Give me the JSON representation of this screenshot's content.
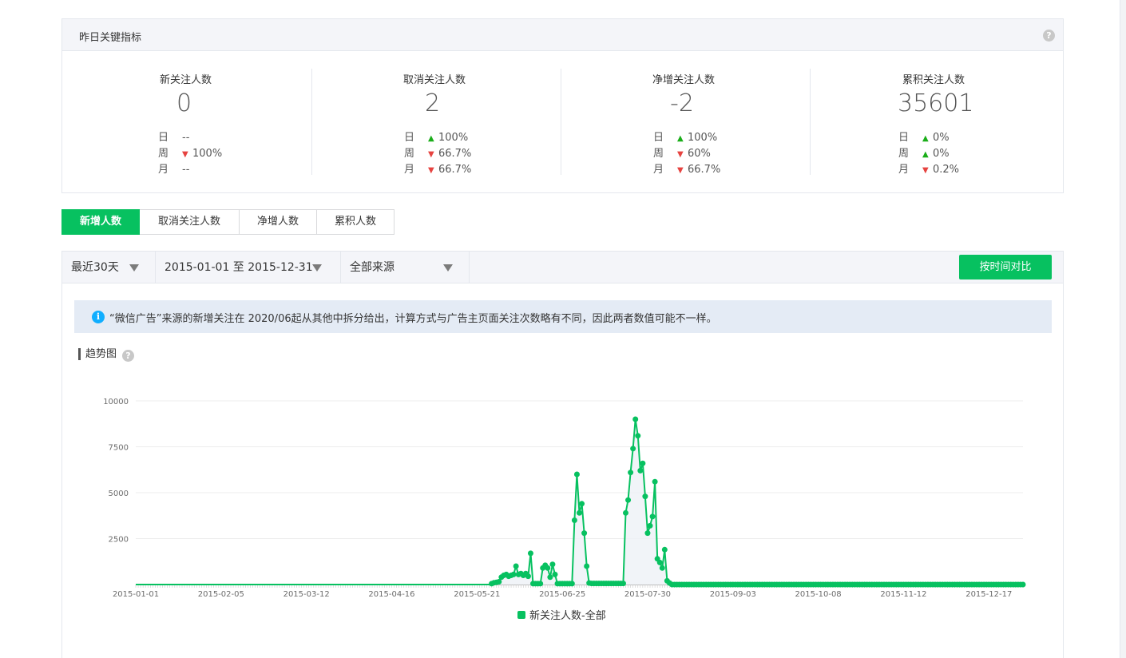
{
  "metrics": {
    "title": "昨日关键指标",
    "help_icon": "question-icon",
    "cards": [
      {
        "name": "新关注人数",
        "value": "0",
        "rows": [
          {
            "label": "日",
            "dir": "",
            "value": "--"
          },
          {
            "label": "周",
            "dir": "down",
            "value": "100%"
          },
          {
            "label": "月",
            "dir": "",
            "value": "--"
          }
        ]
      },
      {
        "name": "取消关注人数",
        "value": "2",
        "rows": [
          {
            "label": "日",
            "dir": "up",
            "value": "100%"
          },
          {
            "label": "周",
            "dir": "down",
            "value": "66.7%"
          },
          {
            "label": "月",
            "dir": "down",
            "value": "66.7%"
          }
        ]
      },
      {
        "name": "净增关注人数",
        "value": "-2",
        "rows": [
          {
            "label": "日",
            "dir": "up",
            "value": "100%"
          },
          {
            "label": "周",
            "dir": "down",
            "value": "60%"
          },
          {
            "label": "月",
            "dir": "down",
            "value": "66.7%"
          }
        ]
      },
      {
        "name": "累积关注人数",
        "value": "35601",
        "rows": [
          {
            "label": "日",
            "dir": "up",
            "value": "0%"
          },
          {
            "label": "周",
            "dir": "up",
            "value": "0%"
          },
          {
            "label": "月",
            "dir": "down",
            "value": "0.2%"
          }
        ]
      }
    ]
  },
  "tabs": [
    {
      "label": "新增人数",
      "active": true
    },
    {
      "label": "取消关注人数",
      "active": false
    },
    {
      "label": "净增人数",
      "active": false
    },
    {
      "label": "累积人数",
      "active": false
    }
  ],
  "filters": {
    "period": "最近30天",
    "date_range": "2015-01-01 至 2015-12-31",
    "source": "全部来源",
    "compare_button": "按时间对比"
  },
  "notice": {
    "icon": "info-icon",
    "text": "“微信广告”来源的新增关注在 2020/06起从其他中拆分给出，计算方式与广告主页面关注次数略有不同，因此两者数值可能不一样。"
  },
  "trend": {
    "title": "趋势图"
  },
  "colors": {
    "accent": "#07c160",
    "up": "#1aad19",
    "down": "#e64340",
    "info": "#10aeff"
  },
  "chart_data": {
    "type": "line",
    "x_start": "2015-01-01",
    "x_end": "2015-12-31",
    "x_ticks": [
      "2015-01-01",
      "2015-02-05",
      "2015-03-12",
      "2015-04-16",
      "2015-05-21",
      "2015-06-25",
      "2015-07-30",
      "2015-09-03",
      "2015-10-08",
      "2015-11-12",
      "2015-12-17"
    ],
    "y_ticks": [
      2500,
      5000,
      7500,
      10000
    ],
    "ylim": [
      0,
      10000
    ],
    "grid": true,
    "legend_position": "bottom",
    "series": [
      {
        "name": "新关注人数-全部",
        "baseline_value": 0,
        "points": [
          [
            "2015-05-27",
            50
          ],
          [
            "2015-05-28",
            100
          ],
          [
            "2015-05-29",
            120
          ],
          [
            "2015-05-30",
            150
          ],
          [
            "2015-05-31",
            400
          ],
          [
            "2015-06-01",
            500
          ],
          [
            "2015-06-02",
            550
          ],
          [
            "2015-06-03",
            450
          ],
          [
            "2015-06-04",
            500
          ],
          [
            "2015-06-05",
            550
          ],
          [
            "2015-06-06",
            1000
          ],
          [
            "2015-06-07",
            550
          ],
          [
            "2015-06-08",
            600
          ],
          [
            "2015-06-09",
            500
          ],
          [
            "2015-06-10",
            600
          ],
          [
            "2015-06-11",
            450
          ],
          [
            "2015-06-12",
            1700
          ],
          [
            "2015-06-13",
            50
          ],
          [
            "2015-06-14",
            50
          ],
          [
            "2015-06-15",
            50
          ],
          [
            "2015-06-16",
            50
          ],
          [
            "2015-06-17",
            900
          ],
          [
            "2015-06-18",
            1050
          ],
          [
            "2015-06-19",
            900
          ],
          [
            "2015-06-20",
            400
          ],
          [
            "2015-06-21",
            1100
          ],
          [
            "2015-06-22",
            550
          ],
          [
            "2015-06-23",
            50
          ],
          [
            "2015-06-24",
            50
          ],
          [
            "2015-06-25",
            50
          ],
          [
            "2015-06-26",
            50
          ],
          [
            "2015-06-27",
            50
          ],
          [
            "2015-06-28",
            50
          ],
          [
            "2015-06-29",
            50
          ],
          [
            "2015-06-30",
            3500
          ],
          [
            "2015-07-01",
            6000
          ],
          [
            "2015-07-02",
            3900
          ],
          [
            "2015-07-03",
            4400
          ],
          [
            "2015-07-04",
            2800
          ],
          [
            "2015-07-05",
            1000
          ],
          [
            "2015-07-06",
            80
          ],
          [
            "2015-07-07",
            60
          ],
          [
            "2015-07-08",
            60
          ],
          [
            "2015-07-09",
            60
          ],
          [
            "2015-07-10",
            60
          ],
          [
            "2015-07-11",
            60
          ],
          [
            "2015-07-12",
            60
          ],
          [
            "2015-07-13",
            60
          ],
          [
            "2015-07-14",
            60
          ],
          [
            "2015-07-15",
            60
          ],
          [
            "2015-07-16",
            60
          ],
          [
            "2015-07-17",
            60
          ],
          [
            "2015-07-18",
            60
          ],
          [
            "2015-07-19",
            60
          ],
          [
            "2015-07-20",
            60
          ],
          [
            "2015-07-21",
            3900
          ],
          [
            "2015-07-22",
            4600
          ],
          [
            "2015-07-23",
            6100
          ],
          [
            "2015-07-24",
            7400
          ],
          [
            "2015-07-25",
            9000
          ],
          [
            "2015-07-26",
            8100
          ],
          [
            "2015-07-27",
            6200
          ],
          [
            "2015-07-28",
            6600
          ],
          [
            "2015-07-29",
            4800
          ],
          [
            "2015-07-30",
            2800
          ],
          [
            "2015-07-31",
            3200
          ],
          [
            "2015-08-01",
            3700
          ],
          [
            "2015-08-02",
            5600
          ],
          [
            "2015-08-03",
            1400
          ],
          [
            "2015-08-04",
            1200
          ],
          [
            "2015-08-05",
            900
          ],
          [
            "2015-08-06",
            1900
          ],
          [
            "2015-08-07",
            200
          ],
          [
            "2015-08-08",
            80
          ]
        ]
      }
    ]
  }
}
